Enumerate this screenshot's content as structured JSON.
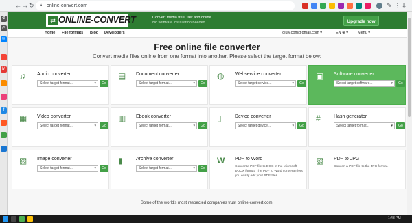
{
  "browser": {
    "url": "online-convert.com",
    "nav": {
      "back": "←",
      "forward": "→",
      "reload": "↻"
    }
  },
  "site": {
    "logo_text": "ONLINE-CONVERT",
    "tagline_1": "Convert media free, fast and online.",
    "tagline_2": "No software installation needed.",
    "upgrade_label": "Upgrade now",
    "nav": [
      "Home",
      "File formats",
      "Blog",
      "Developers"
    ],
    "user_email": "idiuly.com@gmail.com ▾",
    "lang": "EN ⊕ ▾",
    "menu": "Menu ▾"
  },
  "main": {
    "title": "Free online file converter",
    "subtitle": "Convert media files online from one format into another. Please select the target format below:",
    "go_label": "Go",
    "trust_text": "Some of the world's most respected companies trust online-convert.com:"
  },
  "cards": [
    {
      "title": "Audio converter",
      "icon": "♫",
      "placeholder": "Select target format..."
    },
    {
      "title": "Document converter",
      "icon": "▤",
      "placeholder": "Select target format..."
    },
    {
      "title": "Webservice converter",
      "icon": "◍",
      "placeholder": "Select target service..."
    },
    {
      "title": "Software converter",
      "icon": "▣",
      "placeholder": "Select target software..."
    },
    {
      "title": "Video converter",
      "icon": "▦",
      "placeholder": "Select target format..."
    },
    {
      "title": "Ebook converter",
      "icon": "▥",
      "placeholder": "Select target format..."
    },
    {
      "title": "Device converter",
      "icon": "▯",
      "placeholder": "Select target device..."
    },
    {
      "title": "Hash generator",
      "icon": "#",
      "placeholder": "Select target format..."
    },
    {
      "title": "Image converter",
      "icon": "▨",
      "placeholder": "Select target format..."
    },
    {
      "title": "Archive converter",
      "icon": "▮",
      "placeholder": "Select target format..."
    },
    {
      "title": "PDF to Word",
      "icon": "W",
      "description": "Convert a PDF file to DOC in the Microsoft DOCX format. The PDF to Word converter lets you easily edit your PDF files."
    },
    {
      "title": "PDF to JPG",
      "icon": "▧",
      "description": "Convert a PDF file to the JPG format."
    }
  ],
  "colors": {
    "brand_green": "#2e7d32",
    "accent_green": "#43a047",
    "active_card": "#5cb85c"
  },
  "taskbar": {
    "time": "1:43 PM"
  }
}
